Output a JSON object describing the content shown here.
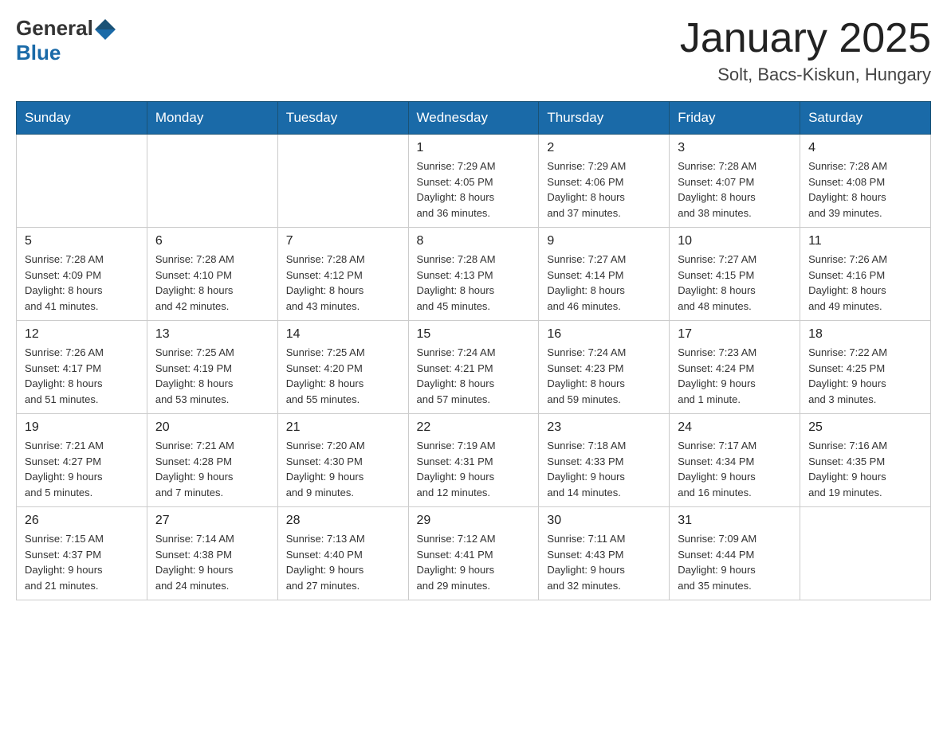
{
  "header": {
    "logo_general": "General",
    "logo_blue": "Blue",
    "month_title": "January 2025",
    "location": "Solt, Bacs-Kiskun, Hungary"
  },
  "days_of_week": [
    "Sunday",
    "Monday",
    "Tuesday",
    "Wednesday",
    "Thursday",
    "Friday",
    "Saturday"
  ],
  "weeks": [
    [
      {
        "day": "",
        "info": ""
      },
      {
        "day": "",
        "info": ""
      },
      {
        "day": "",
        "info": ""
      },
      {
        "day": "1",
        "info": "Sunrise: 7:29 AM\nSunset: 4:05 PM\nDaylight: 8 hours\nand 36 minutes."
      },
      {
        "day": "2",
        "info": "Sunrise: 7:29 AM\nSunset: 4:06 PM\nDaylight: 8 hours\nand 37 minutes."
      },
      {
        "day": "3",
        "info": "Sunrise: 7:28 AM\nSunset: 4:07 PM\nDaylight: 8 hours\nand 38 minutes."
      },
      {
        "day": "4",
        "info": "Sunrise: 7:28 AM\nSunset: 4:08 PM\nDaylight: 8 hours\nand 39 minutes."
      }
    ],
    [
      {
        "day": "5",
        "info": "Sunrise: 7:28 AM\nSunset: 4:09 PM\nDaylight: 8 hours\nand 41 minutes."
      },
      {
        "day": "6",
        "info": "Sunrise: 7:28 AM\nSunset: 4:10 PM\nDaylight: 8 hours\nand 42 minutes."
      },
      {
        "day": "7",
        "info": "Sunrise: 7:28 AM\nSunset: 4:12 PM\nDaylight: 8 hours\nand 43 minutes."
      },
      {
        "day": "8",
        "info": "Sunrise: 7:28 AM\nSunset: 4:13 PM\nDaylight: 8 hours\nand 45 minutes."
      },
      {
        "day": "9",
        "info": "Sunrise: 7:27 AM\nSunset: 4:14 PM\nDaylight: 8 hours\nand 46 minutes."
      },
      {
        "day": "10",
        "info": "Sunrise: 7:27 AM\nSunset: 4:15 PM\nDaylight: 8 hours\nand 48 minutes."
      },
      {
        "day": "11",
        "info": "Sunrise: 7:26 AM\nSunset: 4:16 PM\nDaylight: 8 hours\nand 49 minutes."
      }
    ],
    [
      {
        "day": "12",
        "info": "Sunrise: 7:26 AM\nSunset: 4:17 PM\nDaylight: 8 hours\nand 51 minutes."
      },
      {
        "day": "13",
        "info": "Sunrise: 7:25 AM\nSunset: 4:19 PM\nDaylight: 8 hours\nand 53 minutes."
      },
      {
        "day": "14",
        "info": "Sunrise: 7:25 AM\nSunset: 4:20 PM\nDaylight: 8 hours\nand 55 minutes."
      },
      {
        "day": "15",
        "info": "Sunrise: 7:24 AM\nSunset: 4:21 PM\nDaylight: 8 hours\nand 57 minutes."
      },
      {
        "day": "16",
        "info": "Sunrise: 7:24 AM\nSunset: 4:23 PM\nDaylight: 8 hours\nand 59 minutes."
      },
      {
        "day": "17",
        "info": "Sunrise: 7:23 AM\nSunset: 4:24 PM\nDaylight: 9 hours\nand 1 minute."
      },
      {
        "day": "18",
        "info": "Sunrise: 7:22 AM\nSunset: 4:25 PM\nDaylight: 9 hours\nand 3 minutes."
      }
    ],
    [
      {
        "day": "19",
        "info": "Sunrise: 7:21 AM\nSunset: 4:27 PM\nDaylight: 9 hours\nand 5 minutes."
      },
      {
        "day": "20",
        "info": "Sunrise: 7:21 AM\nSunset: 4:28 PM\nDaylight: 9 hours\nand 7 minutes."
      },
      {
        "day": "21",
        "info": "Sunrise: 7:20 AM\nSunset: 4:30 PM\nDaylight: 9 hours\nand 9 minutes."
      },
      {
        "day": "22",
        "info": "Sunrise: 7:19 AM\nSunset: 4:31 PM\nDaylight: 9 hours\nand 12 minutes."
      },
      {
        "day": "23",
        "info": "Sunrise: 7:18 AM\nSunset: 4:33 PM\nDaylight: 9 hours\nand 14 minutes."
      },
      {
        "day": "24",
        "info": "Sunrise: 7:17 AM\nSunset: 4:34 PM\nDaylight: 9 hours\nand 16 minutes."
      },
      {
        "day": "25",
        "info": "Sunrise: 7:16 AM\nSunset: 4:35 PM\nDaylight: 9 hours\nand 19 minutes."
      }
    ],
    [
      {
        "day": "26",
        "info": "Sunrise: 7:15 AM\nSunset: 4:37 PM\nDaylight: 9 hours\nand 21 minutes."
      },
      {
        "day": "27",
        "info": "Sunrise: 7:14 AM\nSunset: 4:38 PM\nDaylight: 9 hours\nand 24 minutes."
      },
      {
        "day": "28",
        "info": "Sunrise: 7:13 AM\nSunset: 4:40 PM\nDaylight: 9 hours\nand 27 minutes."
      },
      {
        "day": "29",
        "info": "Sunrise: 7:12 AM\nSunset: 4:41 PM\nDaylight: 9 hours\nand 29 minutes."
      },
      {
        "day": "30",
        "info": "Sunrise: 7:11 AM\nSunset: 4:43 PM\nDaylight: 9 hours\nand 32 minutes."
      },
      {
        "day": "31",
        "info": "Sunrise: 7:09 AM\nSunset: 4:44 PM\nDaylight: 9 hours\nand 35 minutes."
      },
      {
        "day": "",
        "info": ""
      }
    ]
  ]
}
